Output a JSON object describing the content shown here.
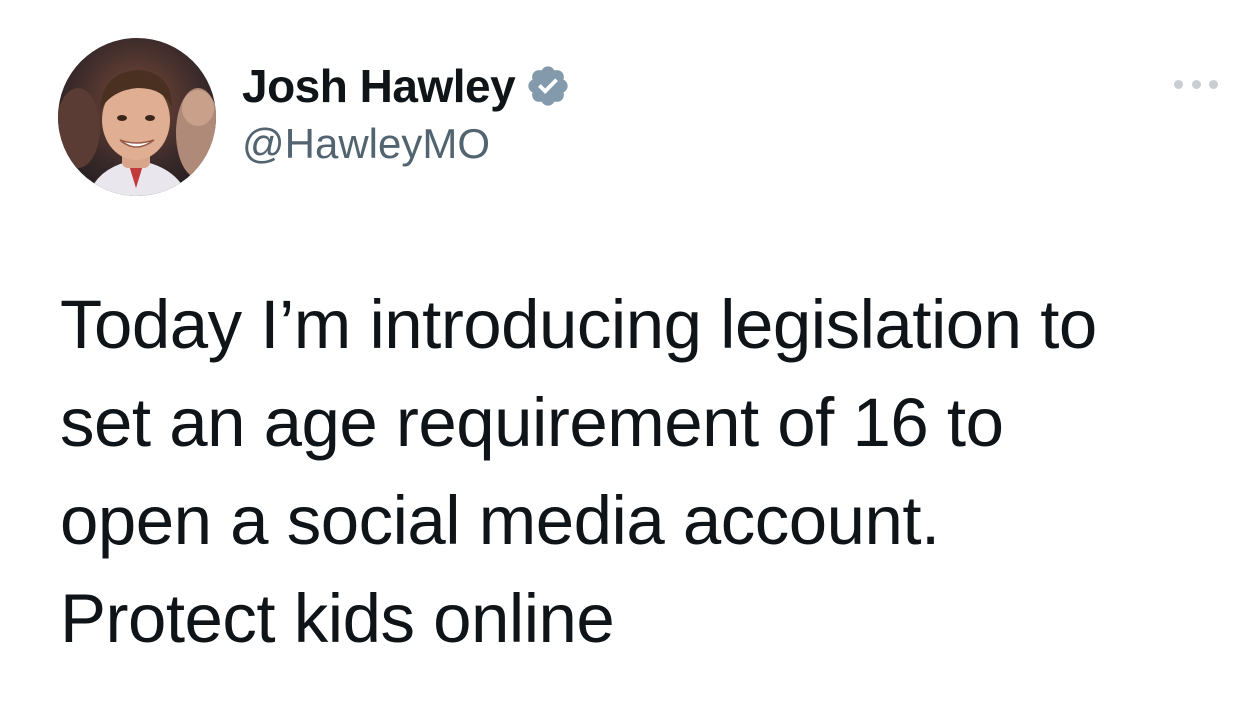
{
  "author": {
    "display_name": "Josh Hawley",
    "handle": "@HawleyMO",
    "verified": true,
    "avatar_icon": "profile-photo",
    "verified_icon": "verified-badge-icon",
    "verified_color": "#829aab"
  },
  "actions": {
    "more_icon": "more-options-icon"
  },
  "tweet": {
    "lines": [
      "Today I’m introducing legislation to",
      "set an age requirement of 16 to",
      "open a social media account.",
      "Protect kids online"
    ]
  },
  "colors": {
    "text": "#0f1419",
    "secondary": "#536471",
    "background": "#ffffff"
  }
}
